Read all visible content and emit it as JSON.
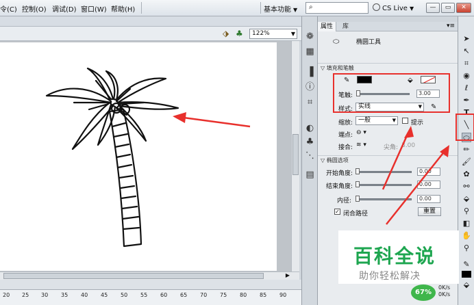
{
  "menubar": {
    "items": [
      "令(C)",
      "控制(O)",
      "调试(D)",
      "窗口(W)",
      "帮助(H)"
    ],
    "workspace": "基本功能",
    "cslive": "CS Live"
  },
  "stage": {
    "zoom": "122%",
    "ruler_labels": [
      "20",
      "25",
      "30",
      "35",
      "40",
      "45",
      "50",
      "55",
      "60",
      "65",
      "70",
      "75",
      "80",
      "85",
      "90"
    ]
  },
  "panel": {
    "tabs": [
      "属性",
      "库"
    ],
    "tool_name": "椭圆工具",
    "fill_stroke_section": "填充和笔触",
    "stroke_label": "笔触:",
    "stroke_value": "3.00",
    "style_label": "样式:",
    "style_value": "实线",
    "scale_label": "缩放:",
    "scale_value": "一般",
    "hint_label": "提示",
    "cap_label": "端点:",
    "join_label": "接合:",
    "miter_label": "尖角:",
    "miter_value": "3.00",
    "ellipse_section": "椭圆选项",
    "start_angle_label": "开始角度:",
    "start_angle_value": "0.00",
    "end_angle_label": "结束角度:",
    "end_angle_value": "0.00",
    "inner_radius_label": "内径:",
    "inner_radius_value": "0.00",
    "close_path_label": "闭合路径",
    "close_path_checked": true,
    "reset_label": "重置"
  },
  "colors": {
    "fill": "#000000",
    "stroke_none_slash": "#e8302c",
    "annotation_red": "#e8302c",
    "watermark_green": "#1ea650"
  },
  "watermark": {
    "title": "百科全说",
    "subtitle": "助你轻松解决"
  },
  "status": {
    "percent": "67%",
    "up": "0K/s",
    "down": "0K/s"
  }
}
